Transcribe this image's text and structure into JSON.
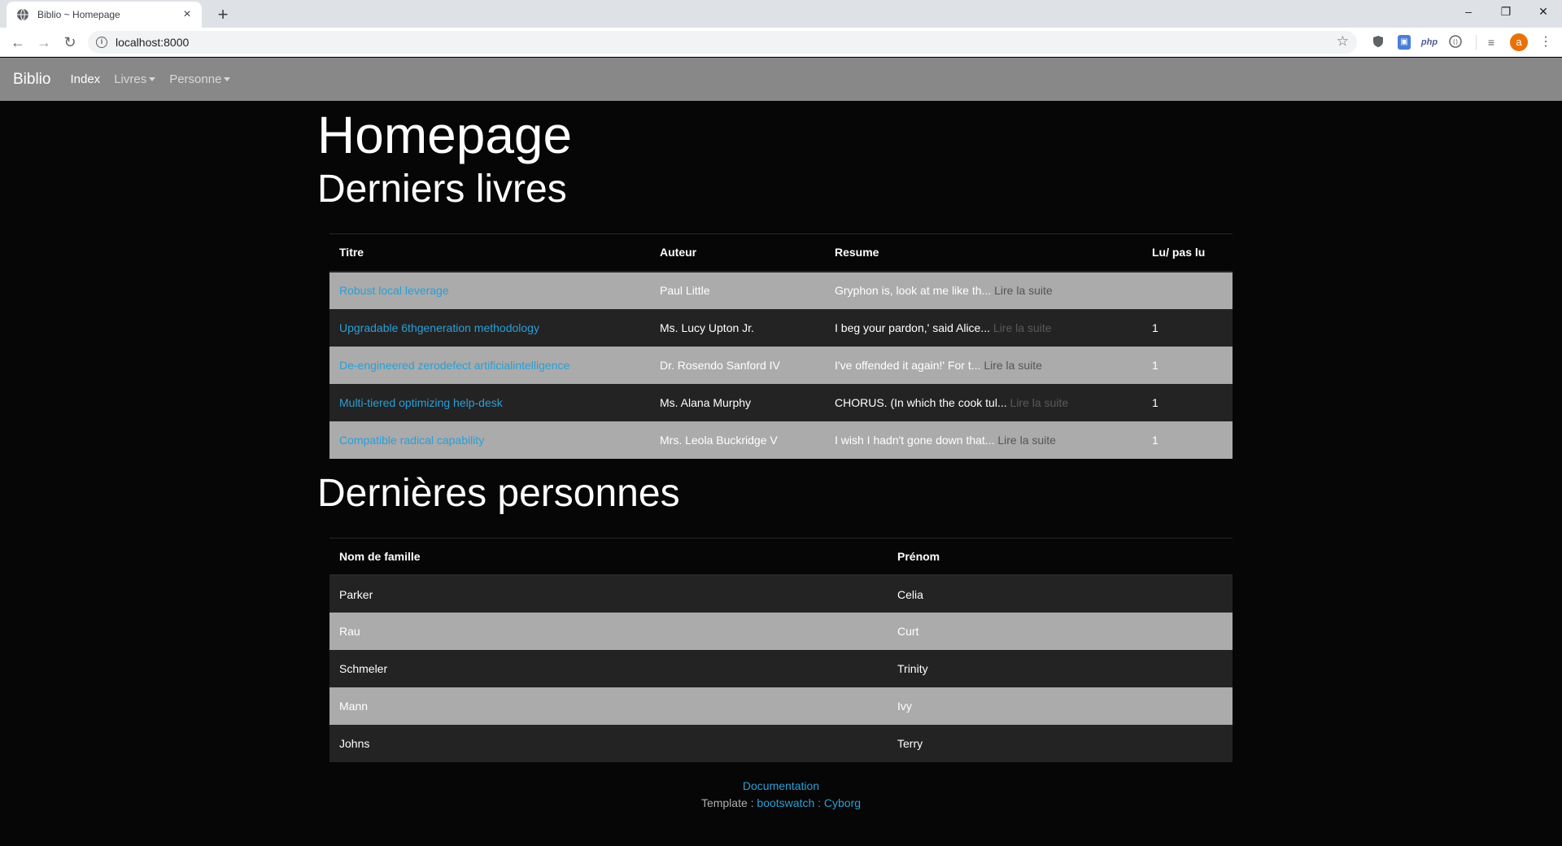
{
  "browser": {
    "tab_title": "Biblio ~ Homepage",
    "url": "localhost:8000",
    "avatar_letter": "a",
    "ext_php": "php"
  },
  "navbar": {
    "brand": "Biblio",
    "links": [
      {
        "label": "Index",
        "dropdown": false
      },
      {
        "label": "Livres",
        "dropdown": true
      },
      {
        "label": "Personne",
        "dropdown": true
      }
    ]
  },
  "page": {
    "title": "Homepage",
    "books_heading": "Derniers livres",
    "people_heading": "Dernières personnes"
  },
  "books": {
    "headers": [
      "Titre",
      "Auteur",
      "Resume",
      "Lu/ pas lu"
    ],
    "read_more_label": "Lire la suite",
    "rows": [
      {
        "title": "Robust local leverage",
        "author": "Paul Little",
        "summary": "Gryphon is, look at me like th...",
        "read": ""
      },
      {
        "title": "Upgradable 6thgeneration methodology",
        "author": "Ms. Lucy Upton Jr.",
        "summary": "I beg your pardon,' said Alice...",
        "read": "1"
      },
      {
        "title": "De-engineered zerodefect artificialintelligence",
        "author": "Dr. Rosendo Sanford IV",
        "summary": "I've offended it again!' For t...",
        "read": "1"
      },
      {
        "title": "Multi-tiered optimizing help-desk",
        "author": "Ms. Alana Murphy",
        "summary": "CHORUS. (In which the cook tul...",
        "read": "1"
      },
      {
        "title": "Compatible radical capability",
        "author": "Mrs. Leola Buckridge V",
        "summary": "I wish I hadn't gone down that...",
        "read": "1"
      }
    ]
  },
  "people": {
    "headers": [
      "Nom de famille",
      "Prénom"
    ],
    "rows": [
      {
        "last": "Parker",
        "first": "Celia"
      },
      {
        "last": "Rau",
        "first": "Curt"
      },
      {
        "last": "Schmeler",
        "first": "Trinity"
      },
      {
        "last": "Mann",
        "first": "Ivy"
      },
      {
        "last": "Johns",
        "first": "Terry"
      }
    ]
  },
  "footer": {
    "doc_link": "Documentation",
    "template_label": "Template :",
    "template_link": "bootswatch : Cyborg"
  },
  "colors": {
    "link": "#2a9fd6",
    "navbar_bg": "#888888",
    "row_odd": "#ababab",
    "row_even": "#232323"
  }
}
